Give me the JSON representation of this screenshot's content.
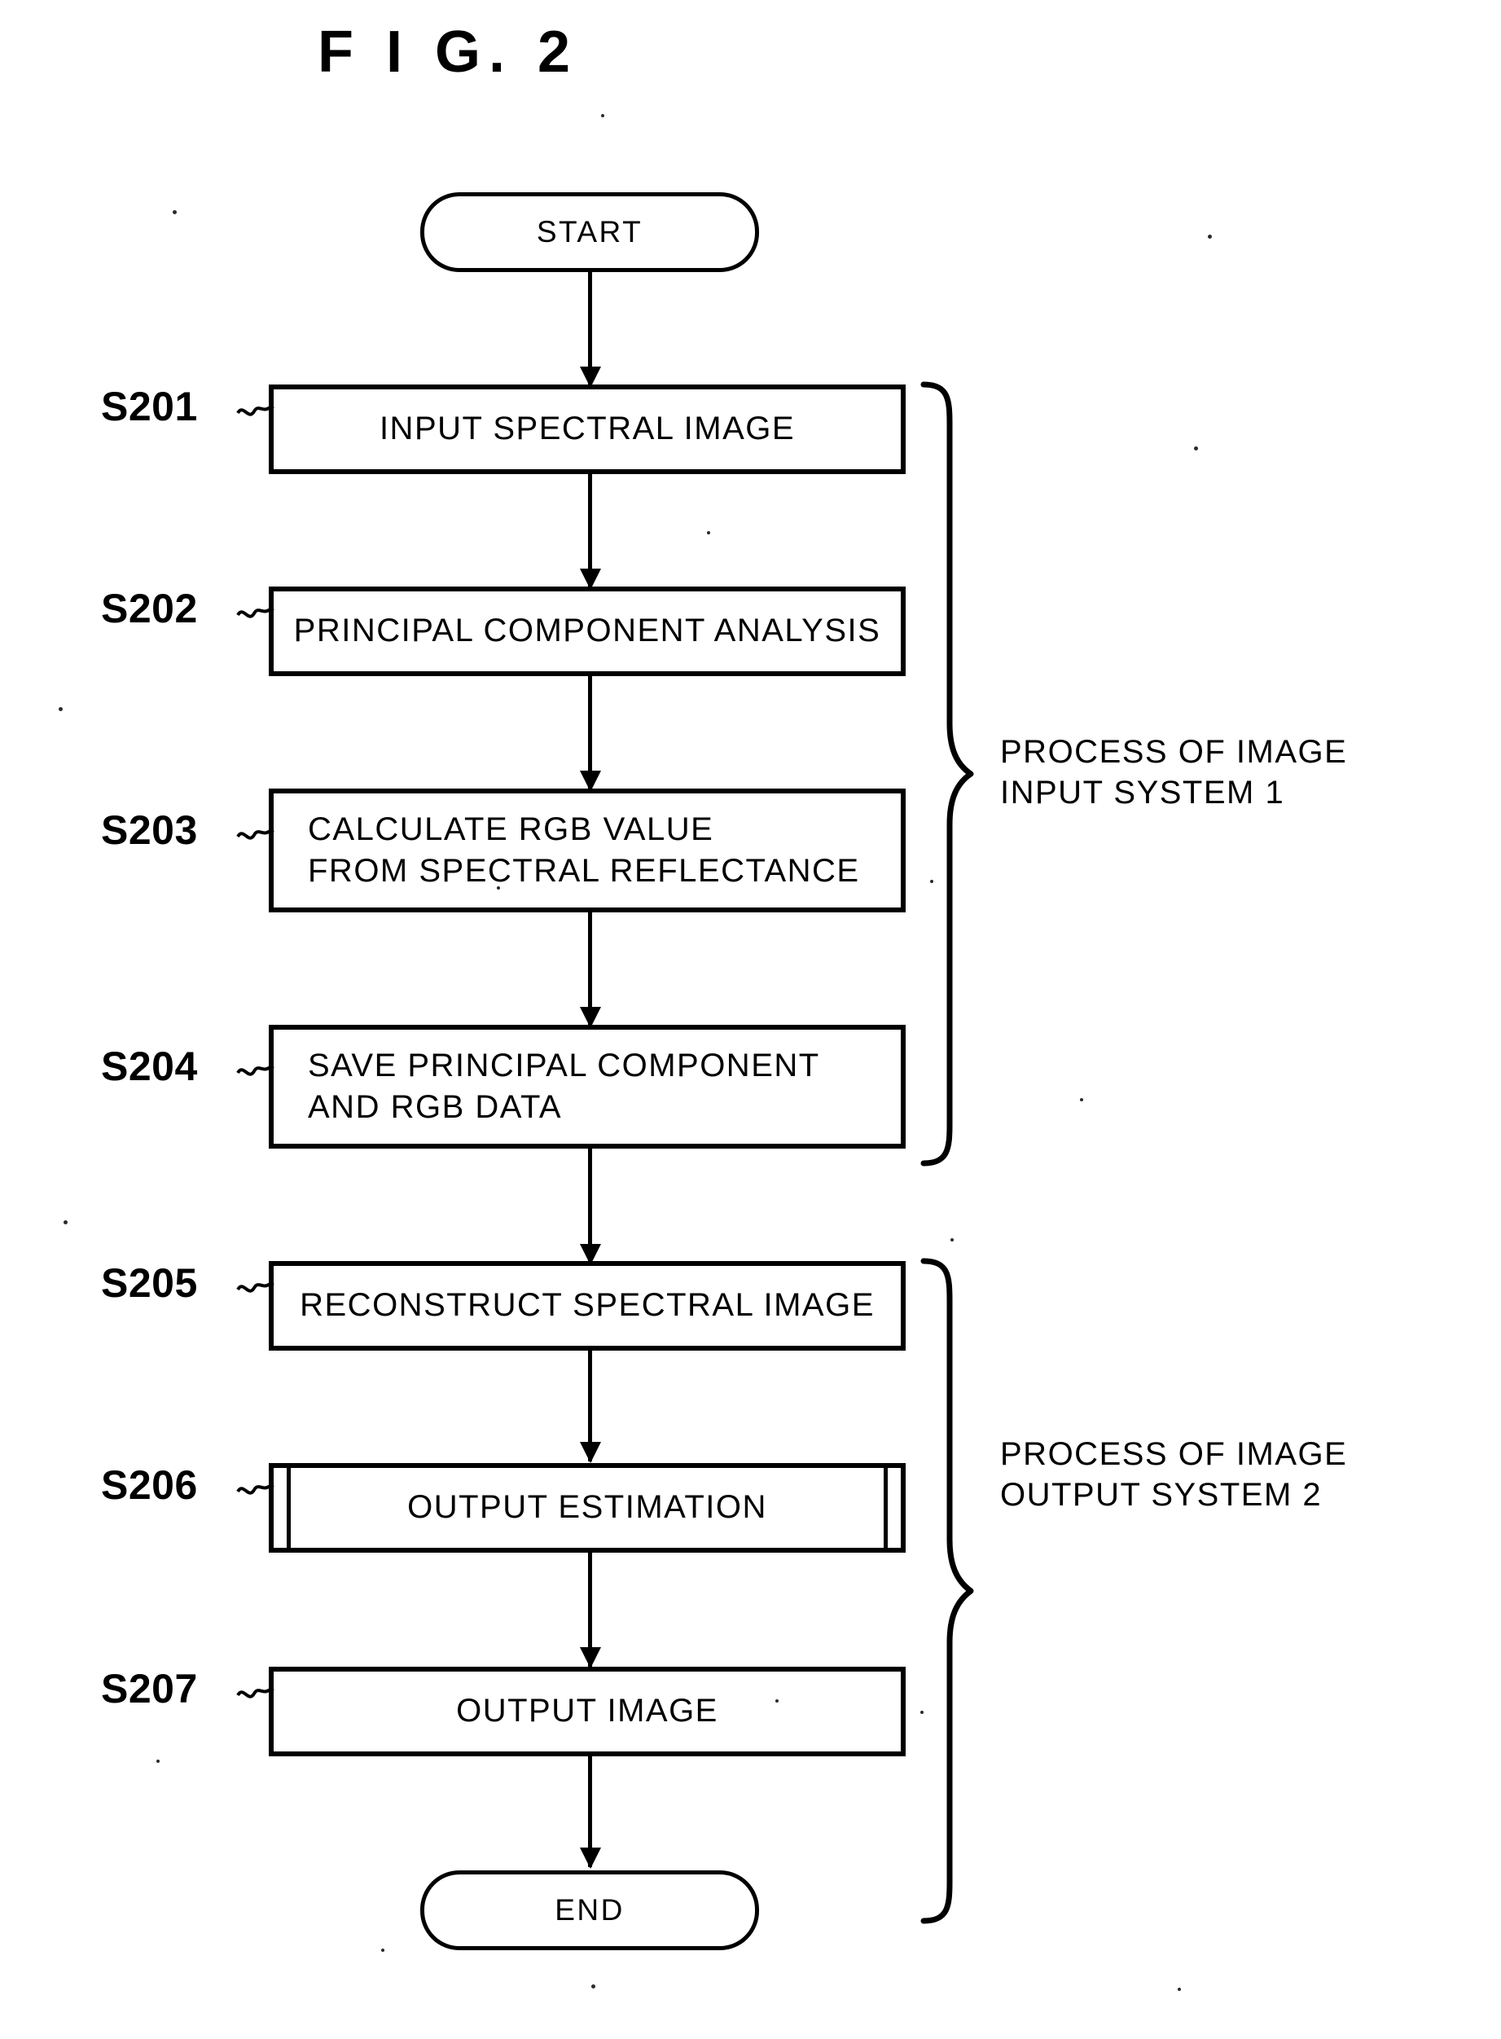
{
  "figure": {
    "title": "F I G.   2"
  },
  "flowchart": {
    "type": "flowchart",
    "start_label": "START",
    "end_label": "END",
    "steps": [
      {
        "tag": "S201",
        "text": "INPUT SPECTRAL IMAGE",
        "shape": "process",
        "align": "center"
      },
      {
        "tag": "S202",
        "text": "PRINCIPAL COMPONENT ANALYSIS",
        "shape": "process",
        "align": "center"
      },
      {
        "tag": "S203",
        "text": "CALCULATE RGB VALUE\nFROM SPECTRAL REFLECTANCE",
        "shape": "process",
        "align": "left"
      },
      {
        "tag": "S204",
        "text": "SAVE PRINCIPAL COMPONENT\nAND RGB DATA",
        "shape": "process",
        "align": "left"
      },
      {
        "tag": "S205",
        "text": "RECONSTRUCT SPECTRAL IMAGE",
        "shape": "process",
        "align": "center"
      },
      {
        "tag": "S206",
        "text": "OUTPUT ESTIMATION",
        "shape": "predefined-process",
        "align": "center"
      },
      {
        "tag": "S207",
        "text": "OUTPUT IMAGE",
        "shape": "process",
        "align": "center"
      }
    ],
    "groups": [
      {
        "caption": "PROCESS OF IMAGE\nINPUT SYSTEM 1",
        "covers": "S201-S204"
      },
      {
        "caption": "PROCESS OF IMAGE\nOUTPUT SYSTEM 2",
        "covers": "S205-S207"
      }
    ]
  },
  "colors": {
    "ink": "#000000",
    "paper": "#ffffff"
  }
}
